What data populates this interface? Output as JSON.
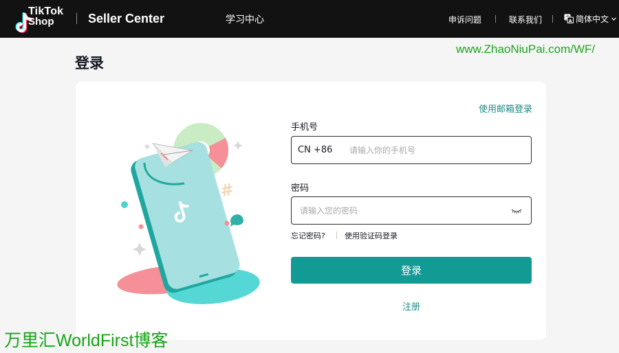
{
  "header": {
    "logo_line1": "TikTok",
    "logo_line2": "Shop",
    "product": "Seller Center",
    "learning_center": "学习中心",
    "appeal": "申诉问题",
    "contact": "联系我们",
    "language": "简体中文",
    "icons": {
      "logo": "tiktok-note-icon",
      "language": "translate-icon",
      "chevron": "chevron-down-icon"
    }
  },
  "watermark_top": "www.ZhaoNiuPai.com/WF/",
  "page": {
    "title": "登录"
  },
  "login": {
    "email_login_link": "使用邮箱登录",
    "phone_label": "手机号",
    "country_code": "CN +86",
    "phone_placeholder": "请输入你的手机号",
    "password_label": "密码",
    "password_placeholder": "请输入您的密码",
    "forgot_password": "忘记密码?",
    "code_login": "使用验证码登录",
    "submit": "登录",
    "register": "注册",
    "password_toggle_icon": "eye-closed-icon"
  },
  "watermark_bottom": "万里汇WorldFirst博客",
  "colors": {
    "accent": "#129a95",
    "link": "#1a8b86",
    "topbar": "#121212",
    "watermark": "#18a418"
  }
}
